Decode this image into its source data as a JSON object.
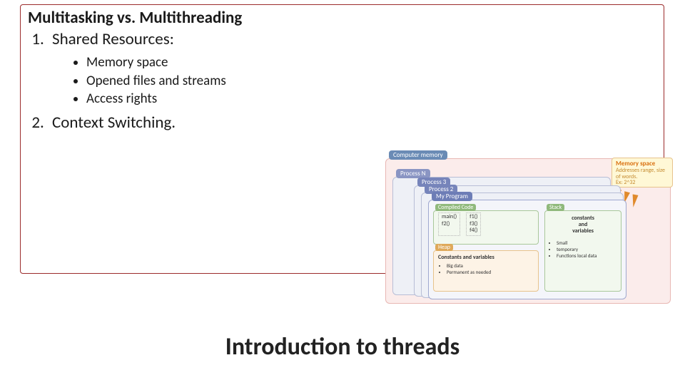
{
  "card": {
    "title": "Multitasking vs. Multithreading",
    "items": [
      {
        "label": "Shared Resources:",
        "sub": [
          "Memory space",
          "Opened files and streams",
          "Access rights"
        ]
      },
      {
        "label": "Context Switching.",
        "sub": []
      }
    ]
  },
  "bottom_title": "Introduction to threads",
  "diagram": {
    "memory_label": "Computer memory",
    "process_n": "Process N",
    "process_3": "Process 3",
    "process_2": "Process 2",
    "program": "My Program",
    "code": {
      "label": "Compiled Code",
      "col1": [
        "main()",
        "f2()"
      ],
      "col2": [
        "f1()",
        "f3()",
        "f4()"
      ]
    },
    "heap": {
      "label": "Heap",
      "title": "Constants and variables",
      "bullets": [
        "Big data",
        "Permanent as needed"
      ]
    },
    "stack": {
      "label": "Stack",
      "title_l1": "constants",
      "title_l2": "and",
      "title_l3": "variables",
      "bullets": [
        "Small",
        "temporary",
        "Functions local data"
      ]
    },
    "memspace": {
      "title": "Memory space",
      "line1": "Addresses range, size of words.",
      "line2": "Ex: 2^32"
    }
  }
}
